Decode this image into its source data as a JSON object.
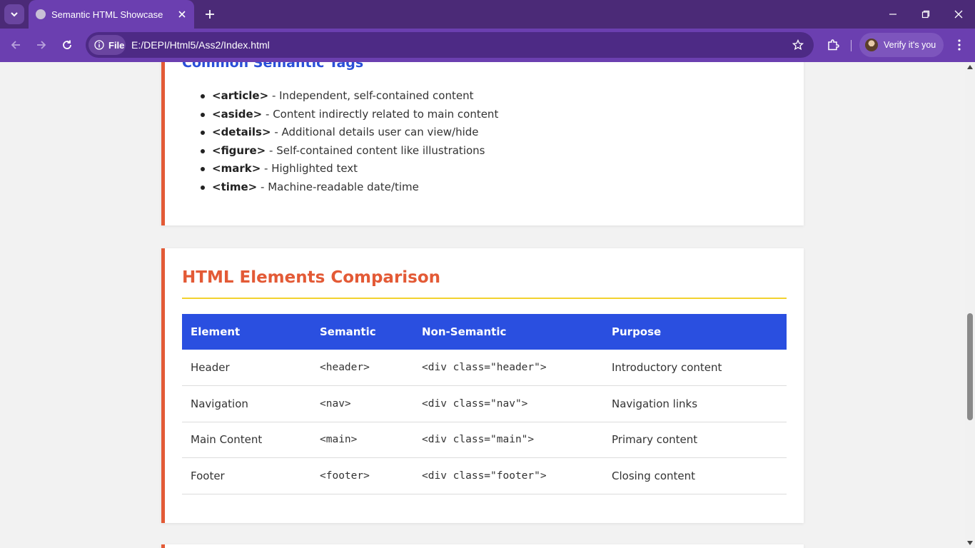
{
  "browser": {
    "tab_title": "Semantic HTML Showcase",
    "site_chip_label": "File",
    "url": "E:/DEPI/Html5/Ass2/Index.html",
    "profile_label": "Verify it's you"
  },
  "section_tags": {
    "title": "Common Semantic Tags",
    "items": [
      {
        "tag": "<article>",
        "desc": " - Independent, self-contained content"
      },
      {
        "tag": "<aside>",
        "desc": " - Content indirectly related to main content"
      },
      {
        "tag": "<details>",
        "desc": " - Additional details user can view/hide"
      },
      {
        "tag": "<figure>",
        "desc": " - Self-contained content like illustrations"
      },
      {
        "tag": "<mark>",
        "desc": " - Highlighted text"
      },
      {
        "tag": "<time>",
        "desc": " - Machine-readable date/time"
      }
    ]
  },
  "section_comparison": {
    "title": "HTML Elements Comparison",
    "headers": [
      "Element",
      "Semantic",
      "Non-Semantic",
      "Purpose"
    ],
    "rows": [
      [
        "Header",
        "<header>",
        "<div class=\"header\">",
        "Introductory content"
      ],
      [
        "Navigation",
        "<nav>",
        "<div class=\"nav\">",
        "Navigation links"
      ],
      [
        "Main Content",
        "<main>",
        "<div class=\"main\">",
        "Primary content"
      ],
      [
        "Footer",
        "<footer>",
        "<div class=\"footer\">",
        "Closing content"
      ]
    ]
  },
  "colors": {
    "accent_orange": "#e35a36",
    "accent_blue": "#2a4fe0",
    "rule_yellow": "#f2d22f",
    "chrome_purple": "#6b3fb0"
  }
}
